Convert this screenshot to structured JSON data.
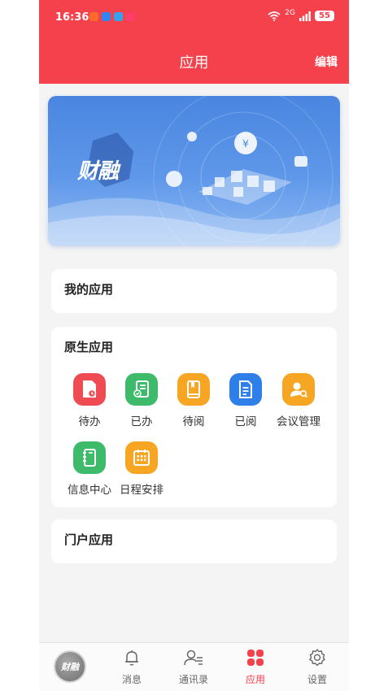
{
  "status_bar": {
    "time": "16:36",
    "network": "2G",
    "battery": "55"
  },
  "header": {
    "title": "应用",
    "edit_label": "编辑"
  },
  "banner": {
    "logo_text": "财融"
  },
  "sections": {
    "my_apps": {
      "title": "我的应用"
    },
    "native_apps": {
      "title": "原生应用",
      "items": [
        {
          "label": "待办",
          "icon": "document-clock-icon",
          "color": "#ef4b52"
        },
        {
          "label": "已办",
          "icon": "document-check-icon",
          "color": "#3dbb6a"
        },
        {
          "label": "待阅",
          "icon": "book-icon",
          "color": "#f6a623"
        },
        {
          "label": "已阅",
          "icon": "document-lines-icon",
          "color": "#2f7fea"
        },
        {
          "label": "会议管理",
          "icon": "meeting-person-icon",
          "color": "#f6a623"
        },
        {
          "label": "信息中心",
          "icon": "notebook-icon",
          "color": "#3dbb6a"
        },
        {
          "label": "日程安排",
          "icon": "calendar-icon",
          "color": "#f6a623"
        }
      ]
    },
    "portal_apps": {
      "title": "门户应用"
    }
  },
  "tabbar": {
    "avatar_text": "财融",
    "items": [
      {
        "label": "消息",
        "icon": "bell-icon"
      },
      {
        "label": "通讯录",
        "icon": "contacts-icon"
      },
      {
        "label": "应用",
        "icon": "apps-grid-icon",
        "active": true
      },
      {
        "label": "设置",
        "icon": "gear-icon"
      }
    ]
  },
  "colors": {
    "brand_red": "#f5414b",
    "banner_blue": "#4a86e0"
  }
}
